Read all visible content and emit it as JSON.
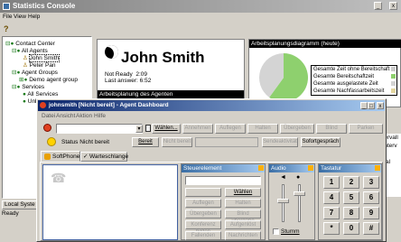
{
  "console": {
    "title": "Statistics Console",
    "menu": [
      "File",
      "View",
      "Help"
    ],
    "tree": {
      "root": "Contact Center",
      "all_agents": "All Agents",
      "agents": [
        "John Smith",
        "Peter Pan"
      ],
      "agent_groups": "Agent Groups",
      "group": "Demo agent group",
      "services": "Services",
      "all_services": "All Services",
      "unknown_services": "Unknown Services"
    },
    "local_tab": "Local Syste",
    "status": "Ready",
    "agent": {
      "name": "John Smith",
      "state_label": "Not Ready",
      "state_time": "2:09",
      "last_answer_label": "Last answer:",
      "last_answer_time": "6:52"
    },
    "schedule_header": "Arbeitsplanung des Agenten",
    "pie_title": "Arbeitsplanungsdiagramm (heute)",
    "legend": [
      "Gesamte Zeit ohne Bereitschaft",
      "Gesamte Bereitschaftzeit",
      "Gesamte ausgelastete Zeit",
      "Gesamte Nachfassarbeitszeit"
    ],
    "pie_values": [
      0.6,
      0.4
    ],
    "right_texts": [
      "Intervall",
      "o Interv",
      "iall",
      "erval"
    ]
  },
  "dashboard": {
    "title": "johnsmith [Nicht bereit] - Agent Dashboard",
    "menu": [
      "Datei",
      "Ansicht",
      "Aktion",
      "Hilfe"
    ],
    "toolbar": [
      "Wählen...",
      "Annehmen",
      "Auflegen",
      "Halten",
      "Übergeben",
      "Blind",
      "Parken"
    ],
    "toolbar_enabled": [
      true,
      false,
      false,
      false,
      false,
      false,
      false
    ],
    "status_label": "Status Nicht bereit",
    "bereit": "Bereit",
    "nicht_bereit": "Nicht bereit",
    "sendeaktivitaet": "Sendeaktivität",
    "sofortgespraech": "Sofortgespräch",
    "tabs": [
      "SoftPhone",
      "Warteschlange"
    ],
    "steuer": {
      "title": "Steuerelement",
      "buttons": [
        [
          "",
          "Wählen"
        ],
        [
          "Auflegen",
          "Halten"
        ],
        [
          "Übergeben",
          "Blind übergabe"
        ],
        [
          "Konferenz bilden",
          "Aufgenlöst"
        ],
        [
          "Fallenden",
          "Nachrichten"
        ]
      ],
      "enabled": [
        [
          "",
          true
        ],
        [
          false,
          false
        ],
        [
          false,
          false
        ],
        [
          false,
          false
        ],
        [
          false,
          false
        ]
      ]
    },
    "audio": {
      "title": "Audio",
      "mute": "Stumm"
    },
    "keypad": {
      "title": "Tastatur",
      "keys": [
        [
          "1",
          "2",
          "3"
        ],
        [
          "4",
          "5",
          "6"
        ],
        [
          "7",
          "8",
          "9"
        ],
        [
          "*",
          "0",
          "#"
        ]
      ]
    }
  },
  "colors": {
    "title_active": "#0a246a",
    "title_active2": "#a6caf0",
    "title_inactive": "#808080",
    "title_inactive2": "#c0c0c0",
    "chrome": "#d4d0c8",
    "pie_green": "#8ed06e",
    "pie_grey": "#d4d4d4",
    "black_bar": "#000000"
  }
}
